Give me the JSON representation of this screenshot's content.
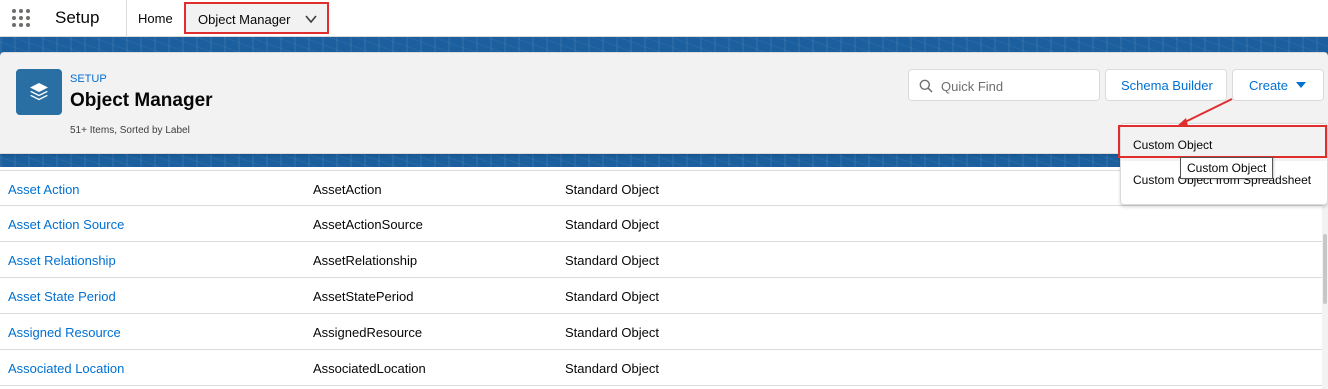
{
  "topnav": {
    "app_name": "Setup",
    "home_tab": "Home",
    "object_manager_tab": "Object Manager"
  },
  "header": {
    "eyebrow": "SETUP",
    "title": "Object Manager",
    "subtitle": "51+ Items, Sorted by Label",
    "icon": "layers-icon"
  },
  "toolbar": {
    "search_placeholder": "Quick Find",
    "schema_builder_label": "Schema Builder",
    "create_label": "Create"
  },
  "create_menu": {
    "items": [
      "Custom Object",
      "Custom Object from Spreadsheet"
    ],
    "tooltip": "Custom Object"
  },
  "objects": [
    {
      "label": "Asset Action",
      "api_name": "AssetAction",
      "type": "Standard Object"
    },
    {
      "label": "Asset Action Source",
      "api_name": "AssetActionSource",
      "type": "Standard Object"
    },
    {
      "label": "Asset Relationship",
      "api_name": "AssetRelationship",
      "type": "Standard Object"
    },
    {
      "label": "Asset State Period",
      "api_name": "AssetStatePeriod",
      "type": "Standard Object"
    },
    {
      "label": "Assigned Resource",
      "api_name": "AssignedResource",
      "type": "Standard Object"
    },
    {
      "label": "Associated Location",
      "api_name": "AssociatedLocation",
      "type": "Standard Object"
    }
  ],
  "colors": {
    "link": "#0070d2",
    "banner": "#1b5f9e",
    "highlight": "#e02d2d"
  }
}
